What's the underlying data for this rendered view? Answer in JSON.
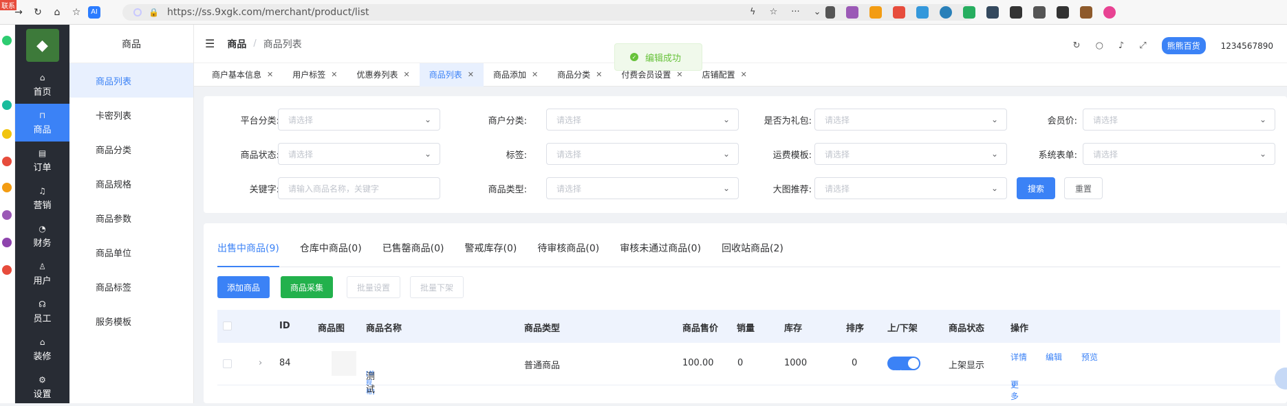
{
  "browser": {
    "badge": "联系",
    "url": "https://ss.9xgk.com/merchant/product/list",
    "ai_label": "AI"
  },
  "nav": {
    "items": [
      {
        "label": "首页",
        "icon": "home-icon",
        "glyph": "⌂"
      },
      {
        "label": "商品",
        "icon": "bag-icon",
        "glyph": "⊓"
      },
      {
        "label": "订单",
        "icon": "order-icon",
        "glyph": "▤"
      },
      {
        "label": "营销",
        "icon": "bell-icon",
        "glyph": "♫"
      },
      {
        "label": "财务",
        "icon": "pie-icon",
        "glyph": "◔"
      },
      {
        "label": "用户",
        "icon": "user-icon",
        "glyph": "♙"
      },
      {
        "label": "员工",
        "icon": "headset-icon",
        "glyph": "☊"
      },
      {
        "label": "装修",
        "icon": "decor-icon",
        "glyph": "⌂"
      },
      {
        "label": "设置",
        "icon": "settings-icon",
        "glyph": "⚙"
      }
    ]
  },
  "subnav": {
    "title": "商品",
    "items": [
      "商品列表",
      "卡密列表",
      "商品分类",
      "商品规格",
      "商品参数",
      "商品单位",
      "商品标签",
      "服务模板"
    ]
  },
  "header": {
    "crumb1": "商品",
    "crumb2": "商品列表",
    "shop": "熊熊百货",
    "account": "1234567890"
  },
  "tags": [
    "商户基本信息",
    "用户标签",
    "优惠券列表",
    "商品列表",
    "商品添加",
    "商品分类",
    "付费会员设置",
    "店铺配置"
  ],
  "toast": "编辑成功",
  "filters": {
    "platform_cat": "平台分类:",
    "merchant_cat": "商户分类:",
    "is_gift": "是否为礼包:",
    "member_price": "会员价:",
    "status": "商品状态:",
    "tag": "标签:",
    "shipping": "运费模板:",
    "form": "系统表单:",
    "keyword": "关键字:",
    "type": "商品类型:",
    "banner": "大图推荐:",
    "select_ph": "请选择",
    "keyword_ph": "请输入商品名称，关键字",
    "search": "搜索",
    "reset": "重置"
  },
  "list": {
    "tabs": [
      "出售中商品(9)",
      "仓库中商品(0)",
      "已售罄商品(0)",
      "警戒库存(0)",
      "待审核商品(0)",
      "审核未通过商品(0)",
      "回收站商品(2)"
    ],
    "actions": {
      "add": "添加商品",
      "collect": "商品采集",
      "batch_set": "批量设置",
      "batch_off": "批量下架"
    },
    "columns": [
      "ID",
      "商品图",
      "商品名称",
      "商品类型",
      "商品售价",
      "销量",
      "库存",
      "排序",
      "上/下架",
      "商品状态",
      "操作"
    ],
    "row": {
      "id": "84",
      "spec": "[单规格]",
      "name": "测试",
      "type": "普通商品",
      "price": "100.00",
      "sales": "0",
      "stock": "1000",
      "sort": "0",
      "switch": "上架",
      "status": "上架显示",
      "op_detail": "详情",
      "op_edit": "编辑",
      "op_preview": "预览",
      "op_more": "更多"
    }
  }
}
